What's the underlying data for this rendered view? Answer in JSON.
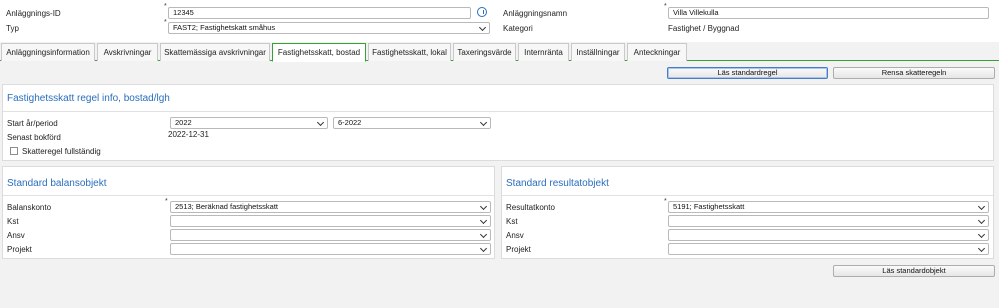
{
  "header": {
    "id_label": "Anläggnings-ID",
    "id_value": "12345",
    "type_label": "Typ",
    "type_value": "FAST2; Fastighetskatt småhus",
    "name_label": "Anläggningsnamn",
    "name_value": "Villa Villekulla",
    "category_label": "Kategori",
    "category_value": "Fastighet / Byggnad",
    "required_mark": "*"
  },
  "tabs": [
    {
      "label": "Anläggningsinformation"
    },
    {
      "label": "Avskrivningar"
    },
    {
      "label": "Skattemässiga avskrivningar"
    },
    {
      "label": "Fastighetsskatt, bostad"
    },
    {
      "label": "Fastighetsskatt, lokal"
    },
    {
      "label": "Taxeringsvärde"
    },
    {
      "label": "Internränta"
    },
    {
      "label": "Inställningar"
    },
    {
      "label": "Anteckningar"
    }
  ],
  "active_tab": "Fastighetsskatt, bostad",
  "actions": {
    "read_standard_rule": "Läs standardregel",
    "clear_tax_rule": "Rensa skatteregeln",
    "read_standard_objects": "Läs standardobjekt"
  },
  "rule_panel": {
    "title": "Fastighetsskatt regel info, bostad/lgh",
    "start_label": "Start år/period",
    "year_value": "2022",
    "period_value": "6-2022",
    "last_booked_label": "Senast bokförd",
    "last_booked_value": "2022-12-31",
    "complete_label": "Skatteregel fullständig",
    "complete_checked": false
  },
  "balance_panel": {
    "title": "Standard balansobjekt",
    "rows": [
      {
        "label": "Balanskonto",
        "value": "2513; Beräknad fastighetsskatt",
        "required": true
      },
      {
        "label": "Kst",
        "value": "",
        "required": false
      },
      {
        "label": "Ansv",
        "value": "",
        "required": false
      },
      {
        "label": "Projekt",
        "value": "",
        "required": false
      }
    ]
  },
  "result_panel": {
    "title": "Standard resultatobjekt",
    "rows": [
      {
        "label": "Resultatkonto",
        "value": "5191; Fastighetsskatt",
        "required": true
      },
      {
        "label": "Kst",
        "value": "",
        "required": false
      },
      {
        "label": "Ansv",
        "value": "",
        "required": false
      },
      {
        "label": "Projekt",
        "value": "",
        "required": false
      }
    ]
  },
  "colors": {
    "accent": "#2a6ebd",
    "active_tab_border": "#36a136"
  }
}
